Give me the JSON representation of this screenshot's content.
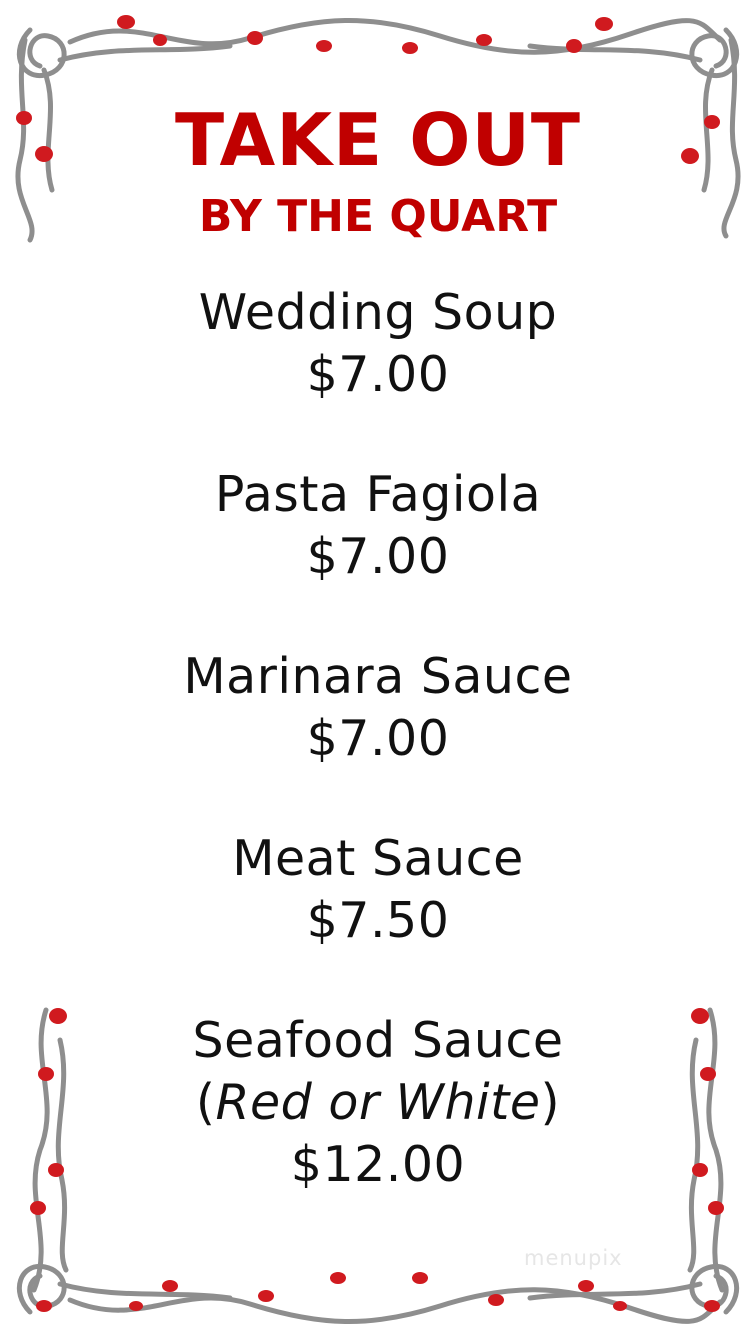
{
  "header": {
    "title": "TAKE OUT",
    "subtitle": "BY THE QUART"
  },
  "menu": {
    "items": [
      {
        "name": "Wedding Soup",
        "note": "",
        "price": "$7.00"
      },
      {
        "name": "Pasta Fagiola",
        "note": "",
        "price": "$7.00"
      },
      {
        "name": "Marinara Sauce",
        "note": "",
        "price": "$7.00"
      },
      {
        "name": "Meat Sauce",
        "note": "",
        "price": "$7.50"
      },
      {
        "name": "Seafood Sauce",
        "note": "Red or White",
        "price": "$12.00"
      }
    ]
  },
  "watermark": "menupix",
  "colors": {
    "heading": "#c00000",
    "vine": "#8e8e8e",
    "flower": "#d01a1f",
    "text": "#111111"
  },
  "decoration": "red-rose-vine-border-icon"
}
